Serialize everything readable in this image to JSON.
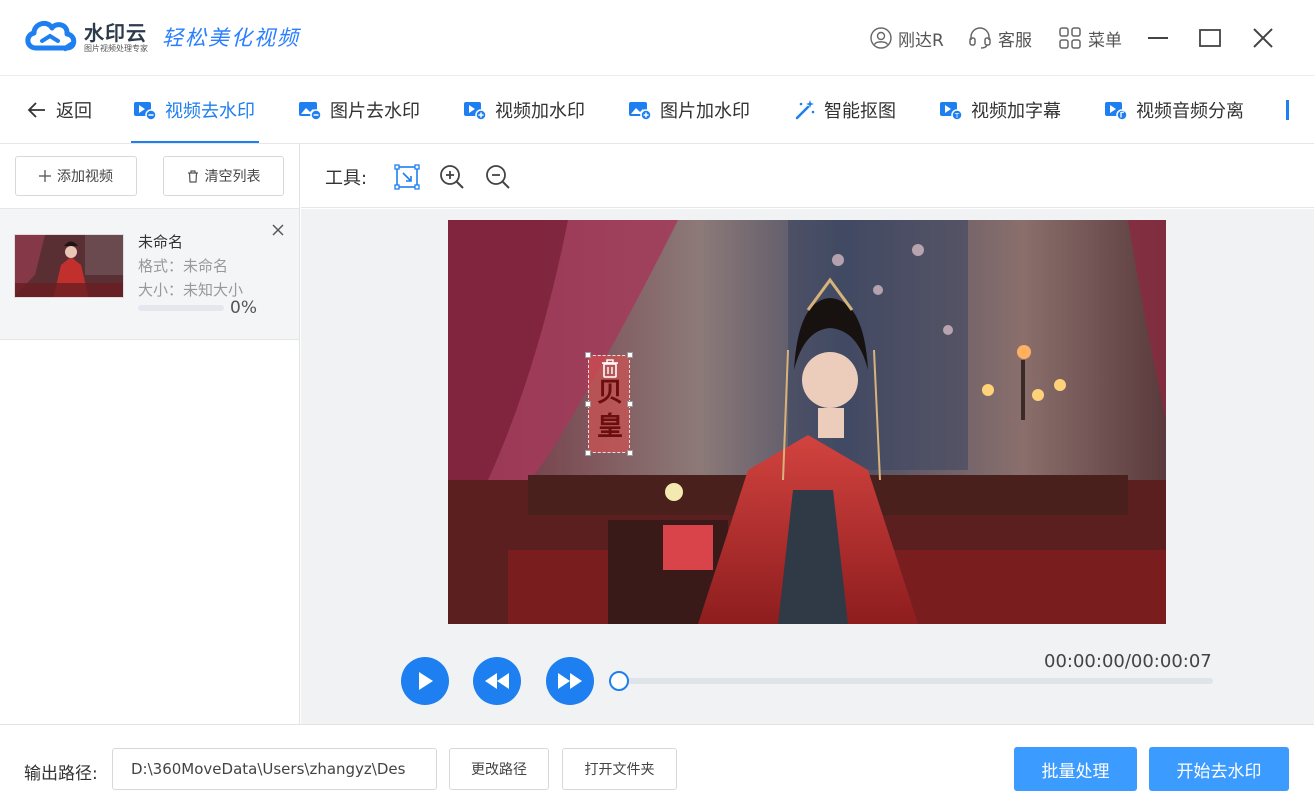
{
  "app": {
    "brand": "水印云",
    "brand_sub": "图片视频处理专家",
    "slogan": "轻松美化视频",
    "user": "刚达R",
    "service": "客服",
    "menu": "菜单"
  },
  "nav": {
    "back": "返回",
    "tabs": [
      {
        "label": "视频去水印",
        "active": true
      },
      {
        "label": "图片去水印"
      },
      {
        "label": "视频加水印"
      },
      {
        "label": "图片加水印"
      },
      {
        "label": "智能抠图"
      },
      {
        "label": "视频加字幕"
      },
      {
        "label": "视频音频分离"
      }
    ]
  },
  "left": {
    "add_video": "添加视频",
    "clear_list": "清空列表",
    "file": {
      "name": "未命名",
      "format": "格式：未命名",
      "size": "大小：未知大小",
      "progress": 0,
      "progress_text": "0%"
    }
  },
  "tools": {
    "label": "工具:",
    "icons": [
      "select-region-icon",
      "zoom-in-icon",
      "zoom-out-icon"
    ]
  },
  "preview": {
    "watermark_text": "贝\n皇"
  },
  "player": {
    "timecode": "00:00:00/00:00:07",
    "position": 0
  },
  "bottom": {
    "output_label": "输出路径:",
    "output_path": "D:\\360MoveData\\Users\\zhangyz\\Des",
    "change_path": "更改路径",
    "open_folder": "打开文件夹",
    "batch": "批量处理",
    "start": "开始去水印"
  },
  "colors": {
    "accent": "#1e7ff0",
    "primary_button": "#3c9bff"
  }
}
